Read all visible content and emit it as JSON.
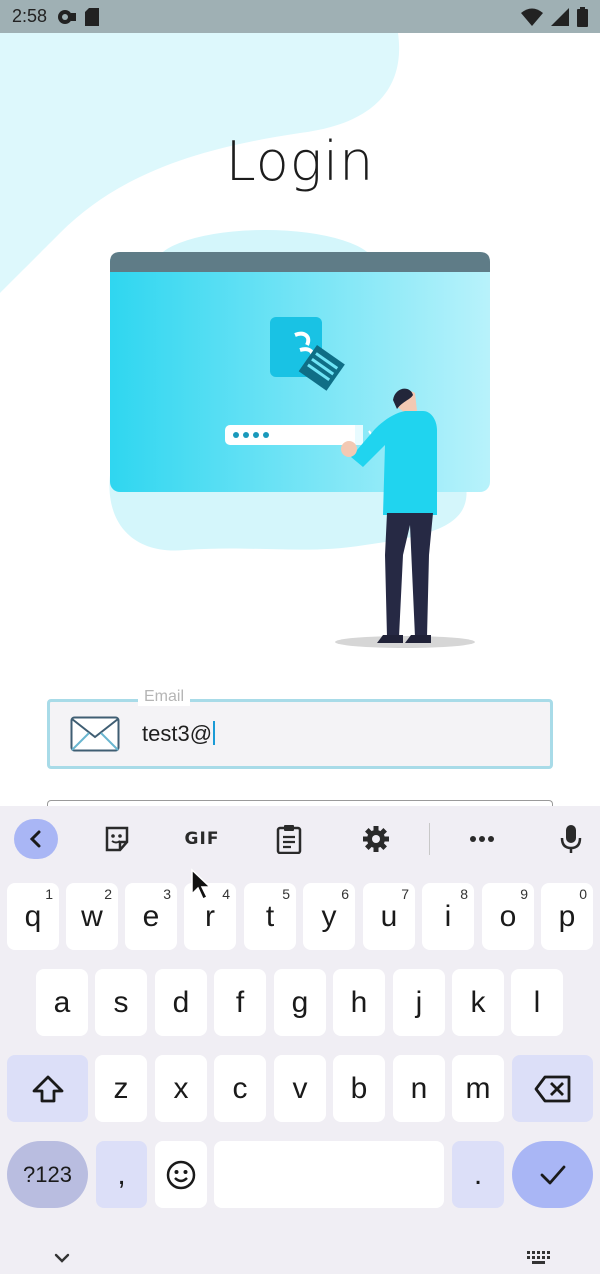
{
  "status_bar": {
    "time": "2:58"
  },
  "page": {
    "title": "Login"
  },
  "email": {
    "label": "Email",
    "value": "test3@"
  },
  "toolbar": {
    "gif_label": "GIF"
  },
  "keyboard": {
    "row1": [
      {
        "key": "q",
        "hint": "1"
      },
      {
        "key": "w",
        "hint": "2"
      },
      {
        "key": "e",
        "hint": "3"
      },
      {
        "key": "r",
        "hint": "4"
      },
      {
        "key": "t",
        "hint": "5"
      },
      {
        "key": "y",
        "hint": "6"
      },
      {
        "key": "u",
        "hint": "7"
      },
      {
        "key": "i",
        "hint": "8"
      },
      {
        "key": "o",
        "hint": "9"
      },
      {
        "key": "p",
        "hint": "0"
      }
    ],
    "row2": [
      "a",
      "s",
      "d",
      "f",
      "g",
      "h",
      "j",
      "k",
      "l"
    ],
    "row3": [
      "z",
      "x",
      "c",
      "v",
      "b",
      "n",
      "m"
    ],
    "symbols_label": "?123",
    "comma_label": ",",
    "period_label": "."
  },
  "colors": {
    "accent": "#a9b6f5",
    "field_border": "#a8dbe8",
    "illustration_cyan": "#2fd6f0"
  }
}
